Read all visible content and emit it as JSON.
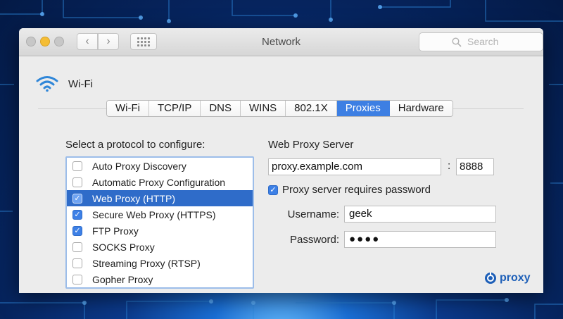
{
  "window": {
    "title": "Network"
  },
  "toolbar": {
    "back_glyph": "‹",
    "forward_glyph": "›",
    "search_placeholder": "Search"
  },
  "interface": {
    "name": "Wi-Fi",
    "icon": "wifi-icon"
  },
  "tabs": [
    {
      "label": "Wi-Fi",
      "active": false
    },
    {
      "label": "TCP/IP",
      "active": false
    },
    {
      "label": "DNS",
      "active": false
    },
    {
      "label": "WINS",
      "active": false
    },
    {
      "label": "802.1X",
      "active": false
    },
    {
      "label": "Proxies",
      "active": true
    },
    {
      "label": "Hardware",
      "active": false
    }
  ],
  "protocols": {
    "heading": "Select a protocol to configure:",
    "items": [
      {
        "label": "Auto Proxy Discovery",
        "checked": false,
        "selected": false
      },
      {
        "label": "Automatic Proxy Configuration",
        "checked": false,
        "selected": false
      },
      {
        "label": "Web Proxy (HTTP)",
        "checked": true,
        "selected": true
      },
      {
        "label": "Secure Web Proxy (HTTPS)",
        "checked": true,
        "selected": false
      },
      {
        "label": "FTP Proxy",
        "checked": true,
        "selected": false
      },
      {
        "label": "SOCKS Proxy",
        "checked": false,
        "selected": false
      },
      {
        "label": "Streaming Proxy (RTSP)",
        "checked": false,
        "selected": false
      },
      {
        "label": "Gopher Proxy",
        "checked": false,
        "selected": false
      }
    ]
  },
  "server": {
    "heading": "Web Proxy Server",
    "host": "proxy.example.com",
    "separator": ":",
    "port": "8888",
    "requires_password_label": "Proxy server requires password",
    "requires_password": true,
    "username_label": "Username:",
    "username": "geek",
    "password_label": "Password:",
    "password_mask": "●●●●"
  },
  "brand": {
    "text": "proxy",
    "color": "#1d5fb8"
  },
  "colors": {
    "accent": "#3d7fe3",
    "selection": "#2f6cc9"
  }
}
